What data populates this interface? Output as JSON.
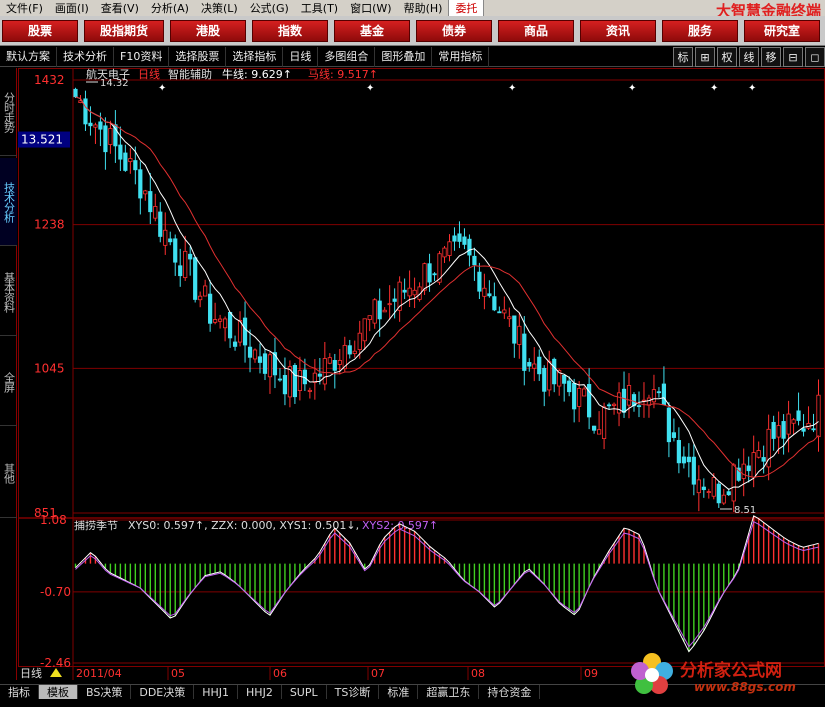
{
  "menu": [
    "文件(F)",
    "画面(I)",
    "查看(V)",
    "分析(A)",
    "决策(L)",
    "公式(G)",
    "工具(T)",
    "窗口(W)",
    "帮助(H)"
  ],
  "menu_active": "委托",
  "brand_title": "大智慧金融终端",
  "top_buttons": [
    "股票",
    "股指期货",
    "港股",
    "指数",
    "基金",
    "债券",
    "商品",
    "资讯",
    "服务",
    "研究室"
  ],
  "toolbar2": {
    "left": [
      "默认方案",
      "技术分析",
      "F10资料",
      "选择股票",
      "选择指标",
      "日线",
      "多图组合",
      "图形叠加",
      "常用指标"
    ],
    "right": [
      "标",
      "⊞",
      "权",
      "线",
      "移",
      "⊟",
      "◻"
    ]
  },
  "left_tabs": [
    "分时走势",
    "技术分析",
    "基本资料",
    "全屏",
    "其他"
  ],
  "chart_header": {
    "stock_name": "航天电子",
    "period": "日线",
    "indicator": "智能辅助",
    "ma1_label": "牛线:",
    "ma1_value": "9.629",
    "ma2_label": "马线:",
    "ma2_value": "9.517"
  },
  "price_axis_labels": [
    "1432",
    "1238",
    "1045",
    "851"
  ],
  "current_price_label": "13.521",
  "high_annotation": "14.32",
  "low_annotation": "8.51",
  "sub_header": {
    "name": "捕捞季节",
    "xys0": "XYS0: 0.597",
    "zzx": "ZZX: 0.000",
    "xys1": "XYS1: 0.501",
    "xys2": "XYS2: 0.597"
  },
  "sub_axis_labels": [
    "1.08",
    "-0.70",
    "-2.46"
  ],
  "date_labels": [
    "2011/04",
    "05",
    "06",
    "07",
    "08",
    "09"
  ],
  "period_label": "日线",
  "bottom_tabs": [
    "指标",
    "模板",
    "BS决策",
    "DDE决策",
    "HHJ1",
    "HHJ2",
    "SUPL",
    "TS诊断",
    "标准",
    "超赢卫东",
    "持仓资金"
  ],
  "bottom_active": "模板",
  "watermark": {
    "cn": "分析家公式网",
    "url": "www.88gs.com"
  },
  "colors": {
    "up": "#ff3030",
    "down": "#40e0f0",
    "ma1": "#ffffff",
    "ma2": "#e03030",
    "bg": "#000000",
    "grid": "#800000"
  },
  "chart_data": [
    {
      "type": "candlestick",
      "title": "航天电子 日线",
      "series_trend": [
        14.1,
        13.8,
        13.5,
        13.2,
        12.9,
        12.4,
        12.0,
        11.6,
        11.2,
        11.0,
        10.8,
        10.6,
        10.4,
        10.2,
        10.3,
        10.5,
        10.8,
        11.0,
        11.2,
        11.4,
        11.6,
        11.8,
        11.9,
        12.0,
        11.7,
        11.3,
        10.9,
        10.5,
        10.3,
        10.2,
        10.0,
        9.8,
        9.9,
        10.1,
        10.3,
        9.7,
        9.3,
        9.0,
        8.8,
        9.1,
        9.3,
        9.5,
        9.6,
        9.7,
        9.9
      ],
      "ylim": [
        8.51,
        14.32
      ],
      "high": 14.32,
      "low": 8.51,
      "ma": [
        {
          "name": "牛线",
          "last": 9.629
        },
        {
          "name": "马线",
          "last": 9.517
        }
      ]
    },
    {
      "type": "bar",
      "title": "捕捞季节",
      "series_values": [
        -0.1,
        0.3,
        -0.2,
        -0.4,
        -0.6,
        -1.0,
        -1.4,
        -0.8,
        -0.3,
        -0.2,
        -0.5,
        -0.9,
        -1.3,
        -0.7,
        -0.2,
        0.2,
        0.9,
        0.5,
        -0.2,
        0.6,
        1.0,
        0.8,
        0.4,
        0.1,
        -0.4,
        -0.7,
        -1.1,
        -0.6,
        -0.1,
        -0.5,
        -1.0,
        -1.3,
        -0.4,
        0.3,
        0.9,
        0.7,
        -0.6,
        -1.4,
        -2.2,
        -1.6,
        -0.8,
        -0.2,
        1.2,
        0.9,
        0.6,
        0.4,
        0.5
      ],
      "ylim": [
        -2.46,
        1.08
      ]
    }
  ]
}
